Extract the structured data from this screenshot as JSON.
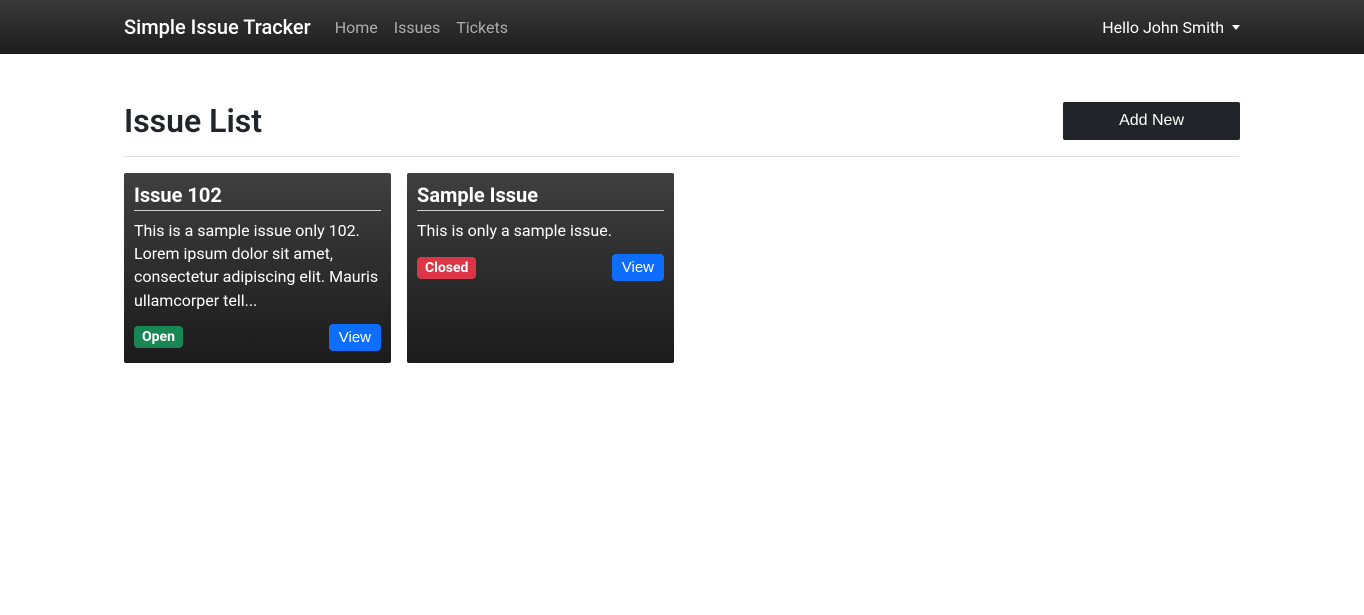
{
  "navbar": {
    "brand": "Simple Issue Tracker",
    "links": [
      {
        "label": "Home"
      },
      {
        "label": "Issues"
      },
      {
        "label": "Tickets"
      }
    ],
    "user_greeting": "Hello John Smith"
  },
  "page": {
    "title": "Issue List",
    "add_button": "Add New"
  },
  "issues": [
    {
      "title": "Issue 102",
      "description": "This is a sample issue only 102. Lorem ipsum dolor sit amet, consectetur adipiscing elit. Mauris ullamcorper tell...",
      "status": "Open",
      "status_class": "open",
      "view_label": "View"
    },
    {
      "title": "Sample Issue",
      "description": "This is only a sample issue.",
      "status": "Closed",
      "status_class": "closed",
      "view_label": "View"
    }
  ]
}
